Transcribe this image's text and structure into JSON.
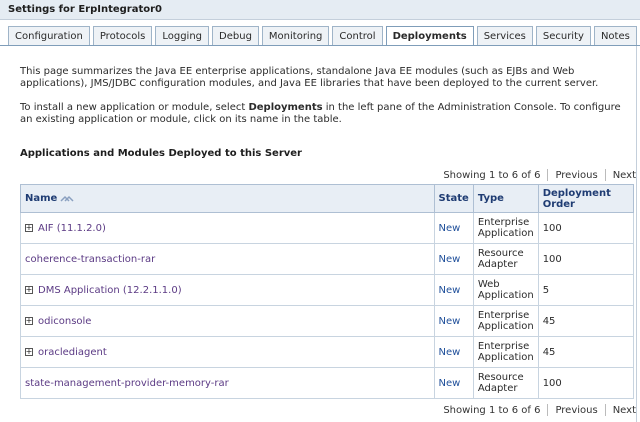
{
  "window": {
    "title": "Settings for ErpIntegrator0"
  },
  "tabs": [
    {
      "label": "Configuration"
    },
    {
      "label": "Protocols"
    },
    {
      "label": "Logging"
    },
    {
      "label": "Debug"
    },
    {
      "label": "Monitoring"
    },
    {
      "label": "Control"
    },
    {
      "label": "Deployments"
    },
    {
      "label": "Services"
    },
    {
      "label": "Security"
    },
    {
      "label": "Notes"
    }
  ],
  "active_tab": "Deployments",
  "description": {
    "para1": "This page summarizes the Java EE enterprise applications, standalone Java EE modules (such as EJBs and Web applications), JMS/JDBC configuration modules, and Java EE libraries that have been deployed to the current server.",
    "para2_before": "To install a new application or module, select ",
    "para2_bold": "Deployments",
    "para2_after": " in the left pane of the Administration Console. To configure an existing application or module, click on its name in the table."
  },
  "section": {
    "title": "Applications and Modules Deployed to this Server"
  },
  "pager": {
    "summary": "Showing 1 to 6 of 6",
    "previous": "Previous",
    "next": "Next"
  },
  "table": {
    "headers": {
      "name": "Name",
      "state": "State",
      "type": "Type",
      "order": "Deployment Order"
    },
    "rows": [
      {
        "name": "AIF (11.1.2.0)",
        "expandable": true,
        "state": "New",
        "type_line1": "Enterprise",
        "type_line2": "Application",
        "order": "100"
      },
      {
        "name": "coherence-transaction-rar",
        "expandable": false,
        "state": "New",
        "type_line1": "Resource",
        "type_line2": "Adapter",
        "order": "100"
      },
      {
        "name": "DMS Application (12.2.1.1.0)",
        "expandable": true,
        "state": "New",
        "type_line1": "Web",
        "type_line2": "Application",
        "order": "5"
      },
      {
        "name": "odiconsole",
        "expandable": true,
        "state": "New",
        "type_line1": "Enterprise",
        "type_line2": "Application",
        "order": "45"
      },
      {
        "name": "oraclediagent",
        "expandable": true,
        "state": "New",
        "type_line1": "Enterprise",
        "type_line2": "Application",
        "order": "45"
      },
      {
        "name": "state-management-provider-memory-rar",
        "expandable": false,
        "state": "New",
        "type_line1": "Resource",
        "type_line2": "Adapter",
        "order": "100"
      }
    ]
  },
  "colors": {
    "header_text": "#1f3c73",
    "app_link": "#5b3a84",
    "state_link": "#1f4f9a",
    "title_bar": "#e5ecf3"
  }
}
